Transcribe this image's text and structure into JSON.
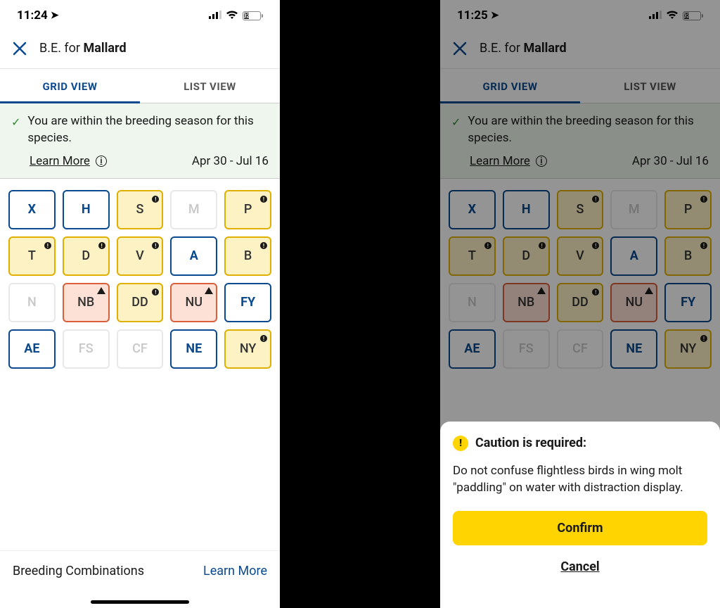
{
  "left": {
    "status": {
      "time": "11:24",
      "battery": "32"
    },
    "header": {
      "prefix": "B.E. for ",
      "species": "Mallard"
    },
    "tabs": {
      "grid": "GRID VIEW",
      "list": "LIST VIEW"
    },
    "banner": {
      "text": "You are within the breeding season for this species.",
      "learn_more": "Learn More",
      "dates": "Apr 30 - Jul 16"
    },
    "codes": [
      {
        "label": "X",
        "style": "blue",
        "corner": null
      },
      {
        "label": "H",
        "style": "blue",
        "corner": null
      },
      {
        "label": "S",
        "style": "yellow",
        "corner": "dot"
      },
      {
        "label": "M",
        "style": "plain",
        "corner": null
      },
      {
        "label": "P",
        "style": "yellow",
        "corner": "dot"
      },
      {
        "label": "T",
        "style": "yellow",
        "corner": "dot"
      },
      {
        "label": "D",
        "style": "yellow",
        "corner": "dot"
      },
      {
        "label": "V",
        "style": "yellow",
        "corner": "dot"
      },
      {
        "label": "A",
        "style": "blue",
        "corner": null
      },
      {
        "label": "B",
        "style": "yellow",
        "corner": "dot"
      },
      {
        "label": "N",
        "style": "plain",
        "corner": null
      },
      {
        "label": "NB",
        "style": "orange",
        "corner": "tri"
      },
      {
        "label": "DD",
        "style": "yellow",
        "corner": "dot"
      },
      {
        "label": "NU",
        "style": "orange",
        "corner": "tri"
      },
      {
        "label": "FY",
        "style": "blue",
        "corner": null
      },
      {
        "label": "AE",
        "style": "blue",
        "corner": null
      },
      {
        "label": "FS",
        "style": "plain",
        "corner": null
      },
      {
        "label": "CF",
        "style": "plain",
        "corner": null
      },
      {
        "label": "NE",
        "style": "blue",
        "corner": null
      },
      {
        "label": "NY",
        "style": "yellow",
        "corner": "dot"
      }
    ],
    "footer": {
      "label": "Breeding Combinations",
      "link": "Learn More"
    }
  },
  "right": {
    "status": {
      "time": "11:25",
      "battery": "32"
    },
    "header": {
      "prefix": "B.E. for ",
      "species": "Mallard"
    },
    "tabs": {
      "grid": "GRID VIEW",
      "list": "LIST VIEW"
    },
    "banner": {
      "text": "You are within the breeding season for this species.",
      "learn_more": "Learn More",
      "dates": "Apr 30 - Jul 16"
    },
    "codes": [
      {
        "label": "X",
        "style": "blue",
        "corner": null
      },
      {
        "label": "H",
        "style": "blue",
        "corner": null
      },
      {
        "label": "S",
        "style": "yellow",
        "corner": "dot"
      },
      {
        "label": "M",
        "style": "plain",
        "corner": null
      },
      {
        "label": "P",
        "style": "yellow",
        "corner": "dot"
      },
      {
        "label": "T",
        "style": "yellow",
        "corner": "dot"
      },
      {
        "label": "D",
        "style": "yellow",
        "corner": "dot"
      },
      {
        "label": "V",
        "style": "yellow",
        "corner": "dot"
      },
      {
        "label": "A",
        "style": "blue",
        "corner": null
      },
      {
        "label": "B",
        "style": "yellow",
        "corner": "dot"
      },
      {
        "label": "N",
        "style": "plain",
        "corner": null
      },
      {
        "label": "NB",
        "style": "orange",
        "corner": "tri"
      },
      {
        "label": "DD",
        "style": "yellow",
        "corner": "dot"
      },
      {
        "label": "NU",
        "style": "orange",
        "corner": "tri"
      },
      {
        "label": "FY",
        "style": "blue",
        "corner": null
      },
      {
        "label": "AE",
        "style": "blue",
        "corner": null
      },
      {
        "label": "FS",
        "style": "plain",
        "corner": null
      },
      {
        "label": "CF",
        "style": "plain",
        "corner": null
      },
      {
        "label": "NE",
        "style": "blue",
        "corner": null
      },
      {
        "label": "NY",
        "style": "yellow",
        "corner": "dot"
      }
    ],
    "sheet": {
      "title": "Caution is required:",
      "body": "Do not confuse flightless birds in wing molt \"paddling\" on water with distraction display.",
      "confirm": "Confirm",
      "cancel": "Cancel"
    }
  }
}
